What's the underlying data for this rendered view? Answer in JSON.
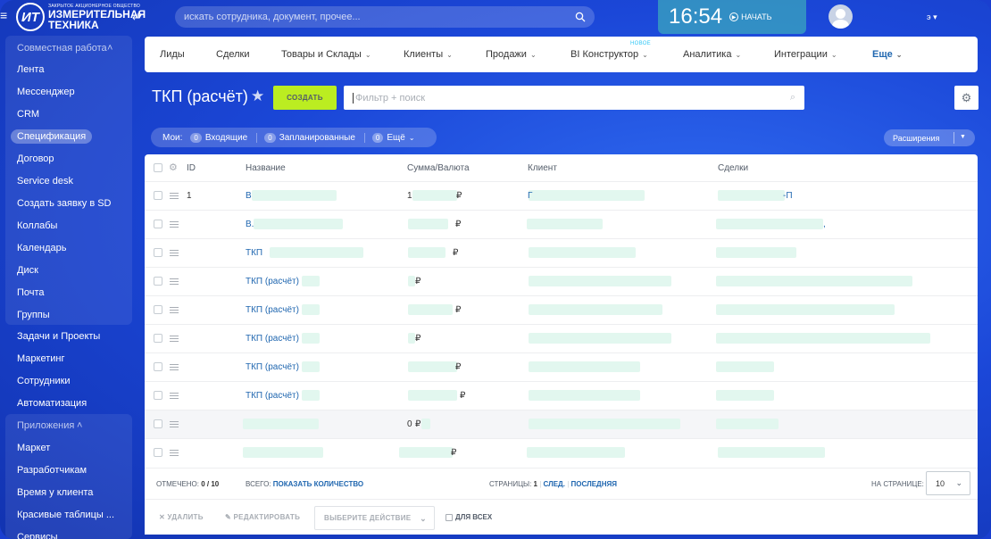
{
  "header": {
    "logo_mark": "ИТ",
    "logo_small": "ЗАКРЫТОЕ АКЦИОНЕРНОЕ ОБЩЕСТВО",
    "logo_line1": "ИЗМЕРИТЕЛЬНАЯ",
    "logo_line2": "ТЕХНИКА",
    "search_placeholder": "искать сотрудника, документ, прочее...",
    "time": "16:54",
    "start_label": "НАЧАТЬ",
    "user_name": "э"
  },
  "sidebar": {
    "group1_title": "Совместная работа",
    "items1": [
      "Лента",
      "Мессенджер",
      "CRM",
      "Спецификация",
      "Договор",
      "Service desk",
      "Создать заявку в SD",
      "Коллабы",
      "Календарь",
      "Диск",
      "Почта",
      "Группы"
    ],
    "items2": [
      "Задачи и Проекты",
      "Маркетинг",
      "Сотрудники",
      "Автоматизация"
    ],
    "group2_title": "Приложения",
    "items3": [
      "Маркет",
      "Разработчикам",
      "Время у клиента",
      "Красивые таблицы ...",
      "Сервисы"
    ]
  },
  "nav": {
    "items": [
      "Лиды",
      "Сделки",
      "Товары и Склады",
      "Клиенты",
      "Продажи",
      "BI Конструктор",
      "Аналитика",
      "Интеграции",
      "Еще"
    ],
    "new_badge": "НОВОЕ"
  },
  "toolbar": {
    "title": "ТКП (расчёт)",
    "create_label": "СОЗДАТЬ",
    "filter_placeholder": "Фильтр + поиск",
    "counters_label": "Мои:",
    "counters": [
      {
        "count": "0",
        "label": "Входящие"
      },
      {
        "count": "0",
        "label": "Запланированные"
      },
      {
        "count": "0",
        "label": "Ещё"
      }
    ],
    "extensions_label": "Расширения"
  },
  "grid": {
    "columns": [
      "ID",
      "Название",
      "Сумма/Валюта",
      "Клиент",
      "Сделки"
    ],
    "rows": [
      {
        "id": "1",
        "name": "В",
        "sum": "1",
        "currency": "₽",
        "client": "Г",
        "deal": "-П"
      },
      {
        "id": "",
        "name": "В.",
        "sum": "",
        "currency": "₽",
        "client": "",
        "deal": ","
      },
      {
        "id": "",
        "name": "ТКП",
        "sum": "",
        "currency": "₽",
        "client": "",
        "deal": ""
      },
      {
        "id": "",
        "name": "ТКП (расчёт)",
        "sum": "",
        "currency": "₽",
        "client": "",
        "deal": ""
      },
      {
        "id": "",
        "name": "ТКП (расчёт)",
        "sum": "",
        "currency": "₽",
        "client": "",
        "deal": ""
      },
      {
        "id": "",
        "name": "ТКП (расчёт)",
        "sum": "",
        "currency": "₽",
        "client": "",
        "deal": ""
      },
      {
        "id": "",
        "name": "ТКП (расчёт)",
        "sum": "",
        "currency": "₽",
        "client": "",
        "deal": ""
      },
      {
        "id": "",
        "name": "ТКП (расчёт)",
        "sum": "",
        "currency": "₽",
        "client": "",
        "deal": ""
      },
      {
        "id": "",
        "name": "",
        "sum": "0",
        "currency": "₽",
        "client": "",
        "deal": ""
      },
      {
        "id": "",
        "name": "",
        "sum": "",
        "currency": "₽",
        "client": "",
        "deal": ""
      }
    ]
  },
  "footer": {
    "selected_label": "ОТМЕЧЕНО:",
    "selected_value": "0 / 10",
    "total_label": "ВСЕГО:",
    "total_link": "ПОКАЗАТЬ КОЛИЧЕСТВО",
    "pages_label": "СТРАНИЦЫ:",
    "page_current": "1",
    "next_label": "СЛЕД.",
    "last_label": "ПОСЛЕДНЯЯ",
    "perpage_label": "НА СТРАНИЦЕ:",
    "perpage_value": "10"
  },
  "actions": {
    "delete_label": "УДАЛИТЬ",
    "edit_label": "РЕДАКТИРОВАТЬ",
    "select_label": "ВЫБЕРИТЕ ДЕЙСТВИЕ",
    "forall_label": "ДЛЯ ВСЕХ"
  }
}
